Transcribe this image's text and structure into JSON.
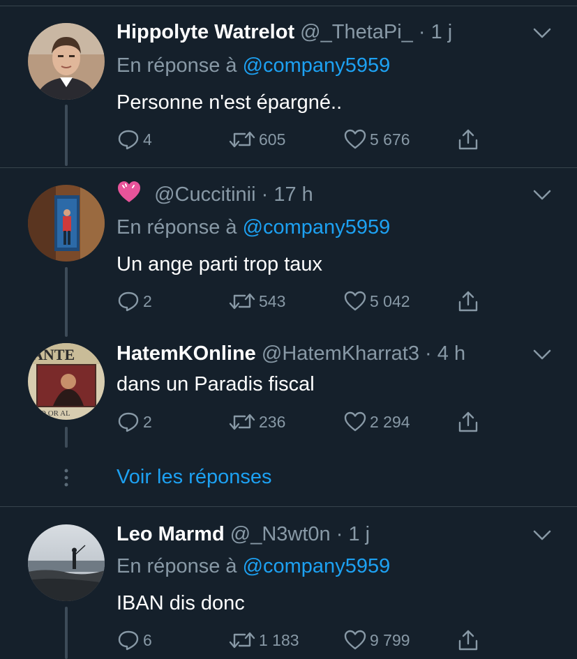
{
  "tweets": [
    {
      "name": "Hippolyte Watrelot",
      "handle": "@_ThetaPi_",
      "dot": "·",
      "time": "1 j",
      "reply_prefix": "En réponse à",
      "reply_mention": "@company5959",
      "text": "Personne n'est épargné..",
      "replies": "4",
      "retweets": "605",
      "likes": "5 676"
    },
    {
      "name": "",
      "emoji": "heart-emoji",
      "handle": "@Cuccitinii",
      "dot": "·",
      "time": "17 h",
      "reply_prefix": "En réponse à",
      "reply_mention": "@company5959",
      "text": "Un ange parti trop taux",
      "replies": "2",
      "retweets": "543",
      "likes": "5 042"
    },
    {
      "name": "HatemKOnline",
      "handle": "@HatemKharrat3",
      "dot": "·",
      "time": "4 h",
      "text": "dans un Paradis fiscal",
      "replies": "2",
      "retweets": "236",
      "likes": "2 294"
    },
    {
      "name": "Leo Marmd",
      "handle": "@_N3wt0n",
      "dot": "·",
      "time": "1 j",
      "reply_prefix": "En réponse à",
      "reply_mention": "@company5959",
      "text": "IBAN dis donc",
      "replies": "6",
      "retweets": "1 183",
      "likes": "9 799"
    }
  ],
  "show_replies_label": "Voir les réponses",
  "colors": {
    "background": "#15202b",
    "secondary_text": "#8899a6",
    "accent": "#1da1f2",
    "divider": "#38444d"
  }
}
